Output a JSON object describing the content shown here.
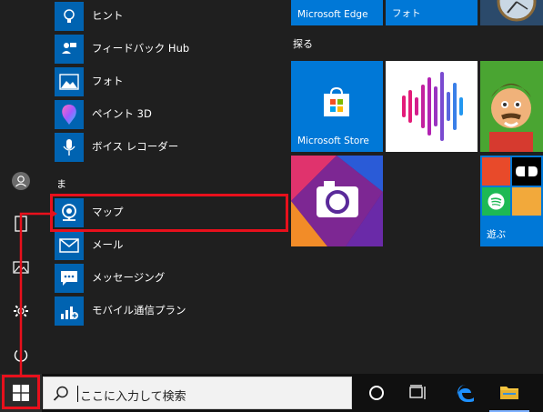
{
  "app_list": {
    "items": [
      {
        "label": "ヒント"
      },
      {
        "label": "フィードバック Hub"
      },
      {
        "label": "フォト"
      },
      {
        "label": "ペイント 3D"
      },
      {
        "label": "ボイス レコーダー"
      },
      {
        "label": "マップ"
      },
      {
        "label": "メール"
      },
      {
        "label": "メッセージング"
      },
      {
        "label": "モバイル通信プラン"
      }
    ],
    "section_letter": "ま"
  },
  "tiles": {
    "top_row": [
      {
        "label": "Microsoft Edge"
      },
      {
        "label": "フォト"
      }
    ],
    "group_title": "探る",
    "store_label": "Microsoft Store",
    "play_label": "遊ぶ"
  },
  "taskbar": {
    "search_placeholder": "ここに入力して検索"
  },
  "colors": {
    "tile_blue": "#0078d7",
    "app_icon_blue": "#0063b1",
    "highlight_red": "#e8101c"
  }
}
